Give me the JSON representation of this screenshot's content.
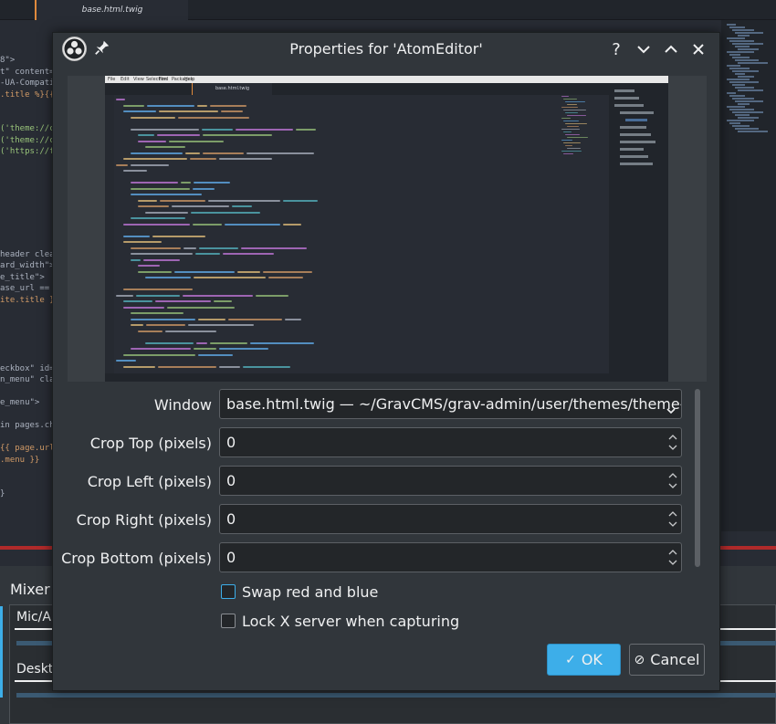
{
  "background": {
    "editor_tab_label": "base.html.twig",
    "code_lines": [
      "8\">",
      "t\" content=\"",
      "-UA-Compatib",
      ".title %}{{",
      "",
      "",
      "('theme://cs",
      "('theme://cs",
      "('https://fo",
      "",
      "",
      "",
      "",
      "",
      "",
      "",
      "",
      "header clear",
      "ard_width\">",
      "e_title\">",
      "ase_url == '",
      "ite.title }}",
      "",
      "",
      "",
      "",
      "",
      "eckbox\" id=\"",
      "n_menu\" clas",
      "",
      "e_menu\">",
      "",
      "in pages.ch",
      "",
      "{{ page.url",
      ".menu }}",
      "",
      "",
      "}"
    ],
    "mixer": {
      "title": "Mixer",
      "channels": [
        "Mic/A",
        "Deskt"
      ]
    }
  },
  "dialog": {
    "title": "Properties for 'AtomEditor'",
    "buttons": {
      "help": "?",
      "ok_label": "OK",
      "cancel_label": "Cancel"
    },
    "preview": {
      "menu_items": [
        "File",
        "Edit",
        "View",
        "Selection",
        "Find",
        "Packages",
        "Help"
      ],
      "tab_label": "base.html.twig"
    },
    "fields": {
      "window": {
        "label": "Window",
        "value": "base.html.twig — ~/GravCMS/grav-admin/user/themes/theme-fi"
      },
      "crop_top": {
        "label": "Crop Top (pixels)",
        "value": "0"
      },
      "crop_left": {
        "label": "Crop Left (pixels)",
        "value": "0"
      },
      "crop_right": {
        "label": "Crop Right (pixels)",
        "value": "0"
      },
      "crop_bottom": {
        "label": "Crop Bottom (pixels)",
        "value": "0"
      }
    },
    "checkboxes": {
      "swap_red_blue": {
        "label": "Swap red and blue",
        "checked": false
      },
      "lock_x_server": {
        "label": "Lock X server when capturing",
        "checked": false
      }
    }
  },
  "colors": {
    "accent": "#3daee9",
    "dialog_bg": "#31363b",
    "field_bg": "#232629"
  }
}
